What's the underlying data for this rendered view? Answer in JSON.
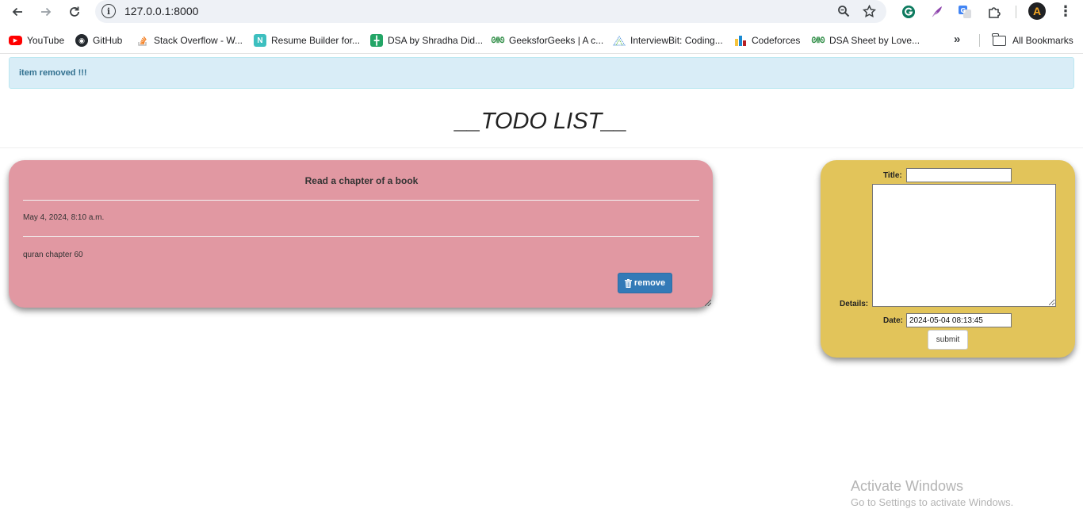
{
  "browser": {
    "url": "127.0.0.1:8000",
    "bookmarks": [
      {
        "label": "YouTube",
        "icon": "youtube-icon"
      },
      {
        "label": "GitHub",
        "icon": "github-icon"
      },
      {
        "label": "Stack Overflow - W...",
        "icon": "stackoverflow-icon"
      },
      {
        "label": "Resume Builder for...",
        "icon": "resume-builder-icon"
      },
      {
        "label": "DSA by Shradha Did...",
        "icon": "sheets-icon"
      },
      {
        "label": "GeeksforGeeks | A c...",
        "icon": "geeksforgeeks-icon"
      },
      {
        "label": "InterviewBit: Coding...",
        "icon": "interviewbit-icon"
      },
      {
        "label": "Codeforces",
        "icon": "codeforces-icon"
      },
      {
        "label": "DSA Sheet by Love...",
        "icon": "geeksforgeeks-icon"
      }
    ],
    "all_bookmarks_label": "All Bookmarks",
    "profile_initial": "A"
  },
  "alert": {
    "message": "item removed !!!"
  },
  "page": {
    "title": "__TODO LIST__"
  },
  "todo": {
    "title": "Read a chapter of a book",
    "date": "May 4, 2024, 8:10 a.m.",
    "details": "quran chapter 60",
    "remove_label": "remove"
  },
  "form": {
    "title_label": "Title:",
    "title_value": "",
    "details_label": "Details:",
    "details_value": "",
    "date_label": "Date:",
    "date_value": "2024-05-04 08:13:45",
    "submit_label": "submit"
  },
  "watermark": {
    "title": "Activate Windows",
    "subtitle": "Go to Settings to activate Windows."
  },
  "colors": {
    "alert_bg": "#d9edf7",
    "alert_text": "#31708f",
    "todo_card": "#e198a2",
    "form_card": "#e2c45a",
    "remove_button": "#337ab7"
  }
}
